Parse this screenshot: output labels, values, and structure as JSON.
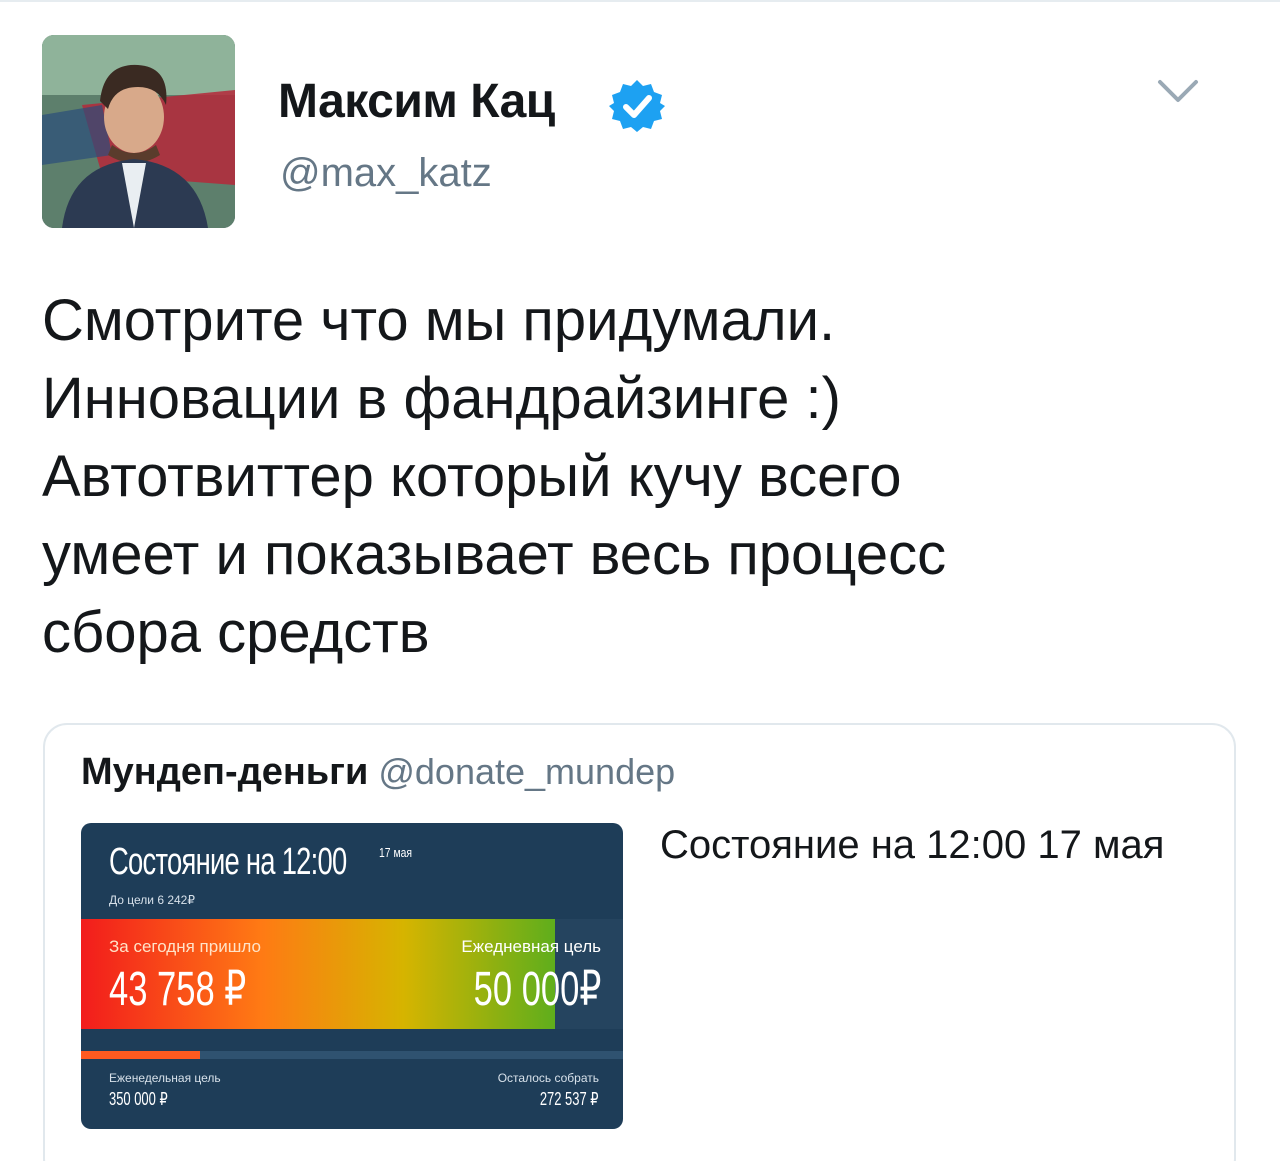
{
  "tweet": {
    "author_name": "Максим Кац",
    "author_handle": "@max_katz",
    "verified": true,
    "text": "Смотрите что мы придумали.\nИнновации в фандрайзинге :)\nАвтотвиттер который кучу всего\nумеет и показывает весь процесс\nсбора средств"
  },
  "quote": {
    "author_name": "Мундеп-деньги",
    "author_handle": "@donate_mundep",
    "text": "Состояние на 12:00 17 мая",
    "image": {
      "title": "Состояние на 12:00",
      "date": "17 мая",
      "goal_remaining": "До цели 6 242₽",
      "today_label": "За сегодня пришло",
      "today_value": "43 758 ₽",
      "daily_goal_label": "Ежедневная цель",
      "daily_goal_value": "50 000₽",
      "daily_progress_fraction": 0.875,
      "weekly_goal_label": "Еженедельная цель",
      "weekly_goal_value": "350 000 ₽",
      "remaining_label": "Осталось собрать",
      "remaining_value": "272 537 ₽",
      "weekly_progress_fraction": 0.22
    }
  },
  "icons": {
    "verified": "verified-badge-icon",
    "menu": "chevron-down-icon"
  },
  "colors": {
    "verified_blue": "#1da1f2",
    "secondary_text": "#657786",
    "card_border": "#e1e8ed",
    "image_bg": "#1e3d58"
  }
}
